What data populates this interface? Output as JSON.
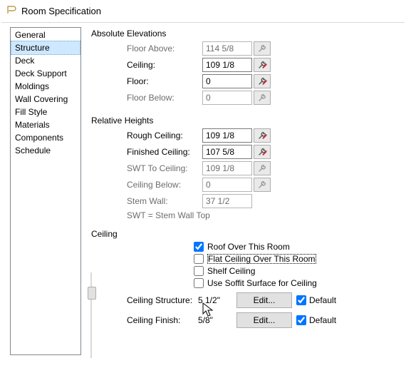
{
  "title": "Room Specification",
  "sidebar": {
    "items": [
      {
        "label": "General",
        "sel": false
      },
      {
        "label": "Structure",
        "sel": true
      },
      {
        "label": "Deck",
        "sel": false
      },
      {
        "label": "Deck Support",
        "sel": false
      },
      {
        "label": "Moldings",
        "sel": false
      },
      {
        "label": "Wall Covering",
        "sel": false
      },
      {
        "label": "Fill Style",
        "sel": false
      },
      {
        "label": "Materials",
        "sel": false
      },
      {
        "label": "Components",
        "sel": false
      },
      {
        "label": "Schedule",
        "sel": false
      }
    ]
  },
  "sections": {
    "absolute": {
      "title": "Absolute Elevations",
      "rows": [
        {
          "label": "Floor Above:",
          "value": "114 5/8\"",
          "enabled": false,
          "wrench": "plain"
        },
        {
          "label": "Ceiling:",
          "value": "109 1/8\"",
          "enabled": true,
          "wrench": "red"
        },
        {
          "label": "Floor:",
          "value": "0\"",
          "enabled": true,
          "wrench": "red"
        },
        {
          "label": "Floor Below:",
          "value": "0\"",
          "enabled": false,
          "wrench": "plain"
        }
      ]
    },
    "relative": {
      "title": "Relative Heights",
      "rows": [
        {
          "label": "Rough Ceiling:",
          "value": "109 1/8\"",
          "enabled": true,
          "wrench": "red"
        },
        {
          "label": "Finished Ceiling:",
          "value": "107 5/8\"",
          "enabled": true,
          "wrench": "red"
        },
        {
          "label": "SWT To Ceiling:",
          "value": "109 1/8\"",
          "enabled": false,
          "wrench": "plain"
        },
        {
          "label": "Ceiling Below:",
          "value": "0\"",
          "enabled": false,
          "wrench": "plain"
        },
        {
          "label": "Stem Wall:",
          "value": "37 1/2\"",
          "enabled": false,
          "wrench": "none"
        }
      ],
      "note": "SWT = Stem Wall Top"
    },
    "ceiling": {
      "title": "Ceiling",
      "checkboxes": [
        {
          "label": "Roof Over This Room",
          "checked": true,
          "focus": false
        },
        {
          "label": "Flat Ceiling Over This Room",
          "checked": false,
          "focus": true
        },
        {
          "label": "Shelf Ceiling",
          "checked": false,
          "focus": false
        },
        {
          "label": "Use Soffit Surface for Ceiling",
          "checked": false,
          "focus": false
        }
      ],
      "rows": [
        {
          "label": "Ceiling Structure:",
          "value": "5 1/2\"",
          "button": "Edit...",
          "default_label": "Default",
          "default_checked": true
        },
        {
          "label": "Ceiling Finish:",
          "value": "5/8\"",
          "button": "Edit...",
          "default_label": "Default",
          "default_checked": true
        }
      ]
    }
  }
}
